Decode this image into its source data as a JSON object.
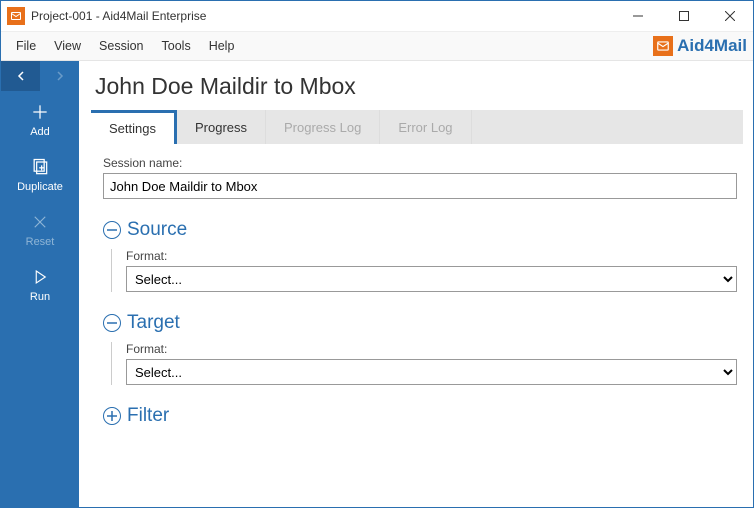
{
  "window": {
    "title": "Project-001 - Aid4Mail Enterprise"
  },
  "menu": {
    "items": [
      "File",
      "View",
      "Session",
      "Tools",
      "Help"
    ],
    "brand": "Aid4Mail"
  },
  "sidebar": {
    "add": "Add",
    "duplicate": "Duplicate",
    "reset": "Reset",
    "run": "Run"
  },
  "page": {
    "title": "John Doe Maildir to Mbox"
  },
  "tabs": {
    "settings": "Settings",
    "progress": "Progress",
    "progressLog": "Progress Log",
    "errorLog": "Error Log"
  },
  "session": {
    "nameLabel": "Session name:",
    "nameValue": "John Doe Maildir to Mbox"
  },
  "source": {
    "heading": "Source",
    "formatLabel": "Format:",
    "formatValue": "Select..."
  },
  "target": {
    "heading": "Target",
    "formatLabel": "Format:",
    "formatValue": "Select..."
  },
  "filter": {
    "heading": "Filter"
  }
}
